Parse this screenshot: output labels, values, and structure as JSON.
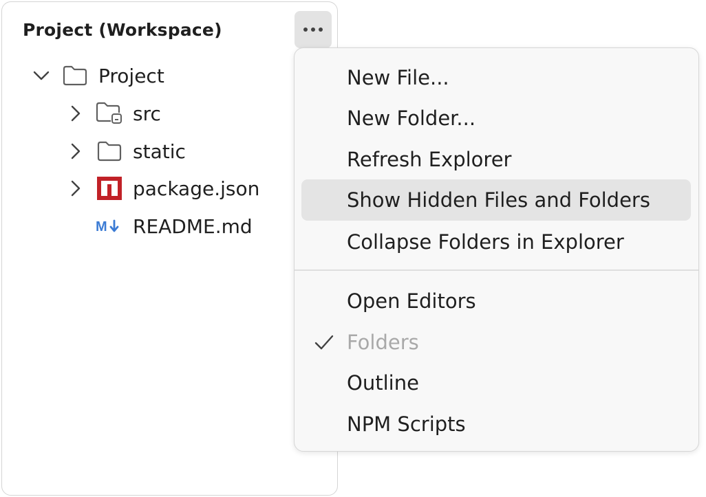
{
  "explorer": {
    "title": "Project (Workspace)",
    "more_icon": "ellipsis-icon",
    "tree": [
      {
        "label": "Project",
        "icon": "folder-icon",
        "expanded": true
      },
      {
        "label": "src",
        "icon": "folder-source-icon",
        "expanded": false
      },
      {
        "label": "static",
        "icon": "folder-icon",
        "expanded": false
      },
      {
        "label": "package.json",
        "icon": "npm-icon",
        "expanded": false
      },
      {
        "label": "README.md",
        "icon": "markdown-icon"
      }
    ]
  },
  "menu": {
    "items": [
      {
        "label": "New File..."
      },
      {
        "label": "New Folder..."
      },
      {
        "label": "Refresh Explorer"
      },
      {
        "label": "Show Hidden Files and Folders",
        "highlighted": true
      },
      {
        "label": "Collapse Folders in Explorer"
      },
      {
        "label": "Open Editors"
      },
      {
        "label": "Folders",
        "checked": true,
        "disabled": true
      },
      {
        "label": "Outline"
      },
      {
        "label": "NPM Scripts"
      }
    ]
  },
  "colors": {
    "npm_red": "#c12127",
    "markdown_blue": "#3b7bd4",
    "highlight": "#e4e4e4",
    "disabled_text": "#a9a9a9"
  }
}
